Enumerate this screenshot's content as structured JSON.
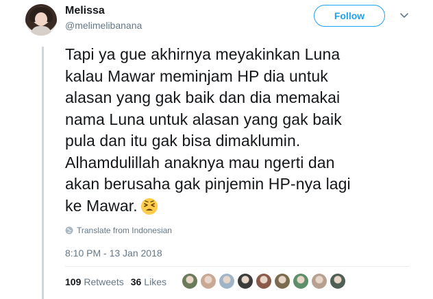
{
  "user": {
    "name": "Melissa",
    "handle": "@melimelibanana"
  },
  "follow_button": {
    "label": "Follow"
  },
  "tweet": {
    "lines": [
      "Tapi ya gue akhirnya meyakinkan Luna",
      "kalau Mawar meminjam HP dia untuk",
      "alasan yang gak baik dan dia memakai",
      "nama Luna untuk alasan yang gak baik",
      "pula dan itu gak bisa dimaklumin.",
      "Alhamdulillah anaknya mau ngerti dan",
      "akan berusaha gak pinjemin HP-nya lagi",
      "ke Mawar."
    ],
    "emoji": "persevering-face-emoji",
    "translate_label": "Translate from Indonesian",
    "timestamp": "8:10 PM - 13 Jan 2018"
  },
  "stats": {
    "retweets_count": "109",
    "retweets_label": "Retweets",
    "likes_count": "36",
    "likes_label": "Likes"
  },
  "likers": [
    {
      "color": "#6b7b5a"
    },
    {
      "color": "#c9a894"
    },
    {
      "color": "#a0b4c8"
    },
    {
      "color": "#3b3b3b"
    },
    {
      "color": "#8a5a4a"
    },
    {
      "color": "#7a6a4f"
    },
    {
      "color": "#5f8f6a"
    },
    {
      "color": "#b8a090"
    },
    {
      "color": "#4f5f55"
    }
  ],
  "colors": {
    "accent": "#1da1f2",
    "text": "#14171a",
    "secondary": "#657786"
  }
}
